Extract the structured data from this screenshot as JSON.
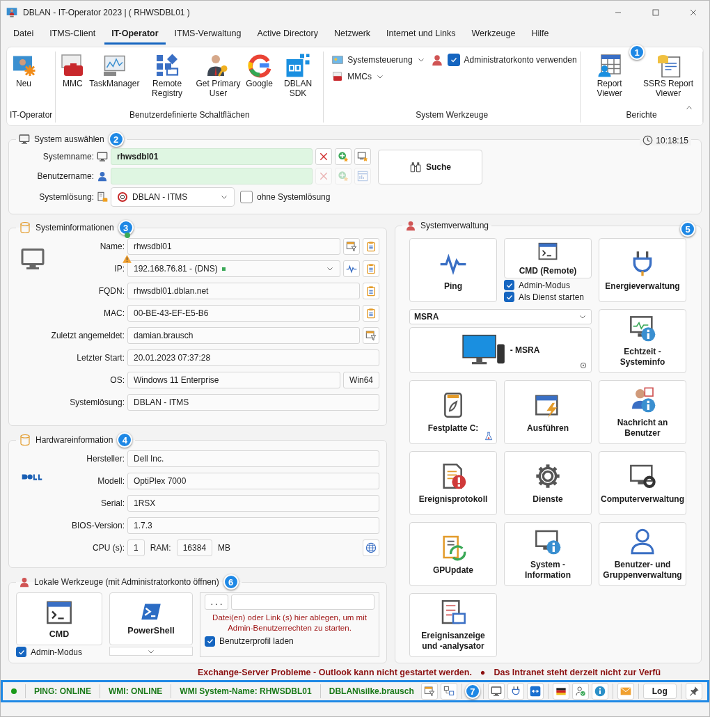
{
  "window": {
    "title": "DBLAN - IT-Operator 2023  |  ( RHWSDBL01 )"
  },
  "menu_tabs": [
    {
      "label": "Datei",
      "selected": false
    },
    {
      "label": "ITMS-Client",
      "selected": false
    },
    {
      "label": "IT-Operator",
      "selected": true
    },
    {
      "label": "ITMS-Verwaltung",
      "selected": false
    },
    {
      "label": "Active Directory",
      "selected": false
    },
    {
      "label": "Netzwerk",
      "selected": false
    },
    {
      "label": "Internet und Links",
      "selected": false
    },
    {
      "label": "Werkzeuge",
      "selected": false
    },
    {
      "label": "Hilfe",
      "selected": false
    }
  ],
  "ribbon": {
    "group_it_operator": {
      "label": "IT-Operator",
      "items": [
        "Neu"
      ]
    },
    "group_custom": {
      "label": "Benutzerdefinierte Schaltflächen",
      "items": [
        "MMC",
        "TaskManager",
        "Remote Registry",
        "Get Primary User",
        "Google",
        "DBLAN SDK"
      ]
    },
    "group_system": {
      "label": "System Werkzeuge",
      "dropdowns": [
        "Systemsteuerung",
        "MMCs"
      ],
      "admin_checkbox": {
        "label": "Administratorkonto verwenden",
        "checked": true
      }
    },
    "group_reports": {
      "label": "Berichte",
      "items": [
        "Report Viewer",
        "SSRS Report Viewer"
      ]
    }
  },
  "callouts": [
    "1",
    "2",
    "3",
    "4",
    "5",
    "6",
    "7"
  ],
  "system_select": {
    "title": "System auswählen",
    "time": "10:18:15",
    "systemname": {
      "label": "Systemname:",
      "value": "rhwsdbl01",
      "buttons_disabled": false
    },
    "benutzername": {
      "label": "Benutzername:",
      "buttons_disabled": true
    },
    "systemloesung": {
      "label": "Systemlösung:",
      "value": "DBLAN - ITMS"
    },
    "ohne_checkbox": {
      "label": "ohne Systemlösung",
      "checked": false
    },
    "search_button": "Suche"
  },
  "system_info": {
    "title": "Systeminformationen",
    "rows": [
      {
        "label": "Name:",
        "value": "rhwsdbl01",
        "kind": "name"
      },
      {
        "label": "IP:",
        "value": "192.168.76.81 - (DNS)",
        "kind": "ip"
      },
      {
        "label": "FQDN:",
        "value": "rhwsdbl01.dblan.net",
        "kind": "copy"
      },
      {
        "label": "MAC:",
        "value": "00-BE-43-EF-E5-B6",
        "kind": "copy"
      },
      {
        "label": "Zuletzt angemeldet:",
        "value": "damian.brausch",
        "kind": "filter"
      },
      {
        "label": "Letzter Start:",
        "value": "20.01.2023 07:37:28",
        "kind": "plain"
      },
      {
        "label": "OS:",
        "value": "Windows 11 Enterprise",
        "extra": "Win64",
        "kind": "os"
      },
      {
        "label": "Systemlösung:",
        "value": "DBLAN - ITMS",
        "kind": "plain"
      }
    ]
  },
  "hardware": {
    "title": "Hardwareinformation",
    "rows": [
      {
        "label": "Hersteller:",
        "value": "Dell Inc."
      },
      {
        "label": "Modell:",
        "value": "OptiPlex 7000"
      },
      {
        "label": "Serial:",
        "value": "1RSX"
      },
      {
        "label": "BIOS-Version:",
        "value": "1.7.3"
      }
    ],
    "cpu_label": "CPU (s):",
    "cpu": "1",
    "ram_label": "RAM:",
    "ram": "16384",
    "ram_unit": "MB"
  },
  "local_tools": {
    "title": "Lokale Werkzeuge (mit Administratorkonto öffnen)",
    "tools": [
      "CMD",
      "PowerShell"
    ],
    "admin_mode": {
      "label": "Admin-Modus",
      "checked": true
    },
    "browse_button": ". . .",
    "hint": "Datei(en) oder Link (s) hier ablegen, um mit Admin-Benutzerrechten zu starten.",
    "profile_checkbox": {
      "label": "Benutzerprofil laden",
      "checked": true
    }
  },
  "system_admin": {
    "title": "Systemverwaltung",
    "tiles": [
      {
        "label": "Ping",
        "kind": "tile"
      },
      {
        "label": "CMD (Remote)",
        "kind": "cmd_remote",
        "options": [
          {
            "label": "Admin-Modus",
            "checked": true
          },
          {
            "label": "Als Dienst starten",
            "checked": true
          }
        ]
      },
      {
        "label": "Energieverwaltung",
        "kind": "tile"
      },
      {
        "label": "- MSRA",
        "kind": "msra",
        "dropdown": "MSRA"
      },
      {
        "label": "Echtzeit - Systeminfo",
        "kind": "tile"
      },
      {
        "label": "Festplatte C:",
        "kind": "tile"
      },
      {
        "label": "Ausführen",
        "kind": "tile"
      },
      {
        "label": "Nachricht an Benutzer",
        "kind": "tile"
      },
      {
        "label": "Ereignisprotokoll",
        "kind": "tile"
      },
      {
        "label": "Dienste",
        "kind": "tile"
      },
      {
        "label": "Computerverwaltung",
        "kind": "tile"
      },
      {
        "label": "GPUpdate",
        "kind": "tile"
      },
      {
        "label": "System - Information",
        "kind": "tile"
      },
      {
        "label": "Benutzer- und Gruppenverwaltung",
        "kind": "tile"
      },
      {
        "label": "Ereignisanzeige und -analysator",
        "kind": "tile"
      }
    ]
  },
  "ticker": {
    "messages": [
      "Exchange-Server Probleme - Outlook kann nicht gestartet werden.",
      "Das Intranet steht derzeit nicht zur Verfü"
    ],
    "separator": "●"
  },
  "status_bar": {
    "online": true,
    "ping": "PING: ONLINE",
    "wmi": "WMI: ONLINE",
    "wmi_name": "WMI System-Name: RHWSDBL01",
    "user": "DBLAN\\silke.brausch",
    "log_button": "Log"
  }
}
